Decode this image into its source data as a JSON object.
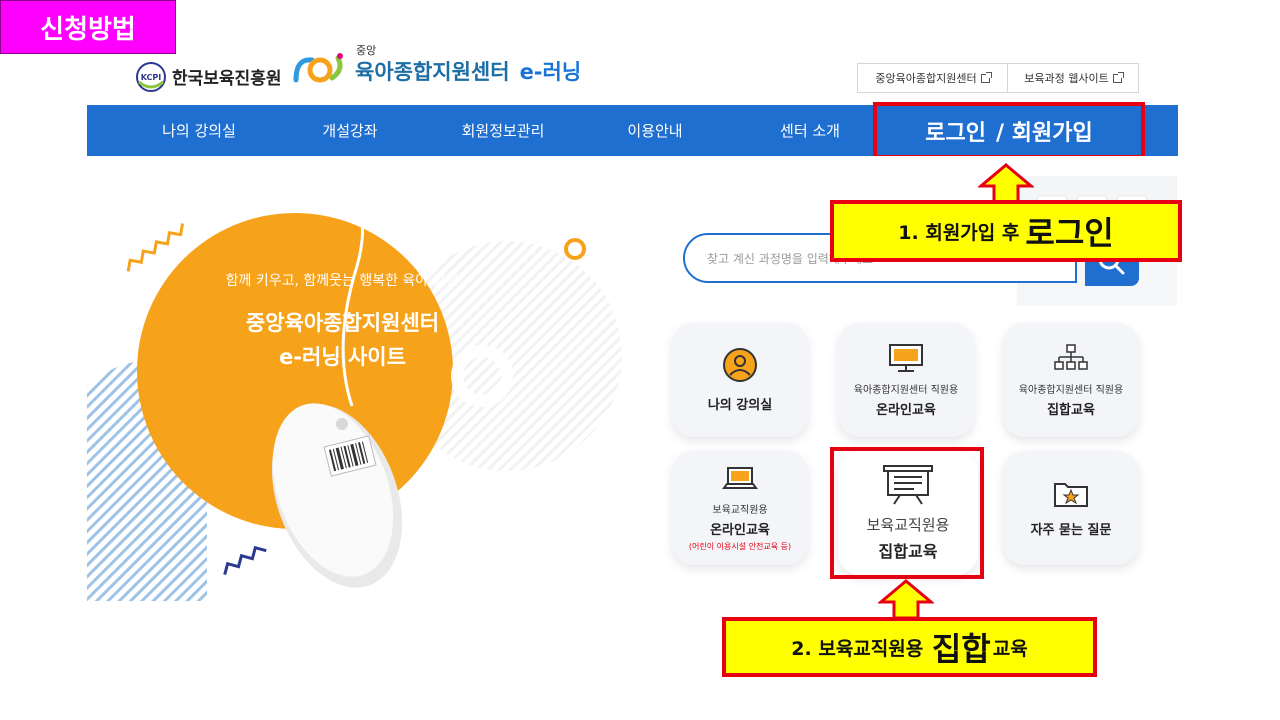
{
  "slide": {
    "title": "신청방법"
  },
  "header": {
    "org_name": "한국보육진흥원",
    "kcpi_badge": "KCPI",
    "center_small": "중앙",
    "center_name": "육아종합지원센터",
    "elearning": "e-러닝",
    "external_links": [
      "중앙육아종합지원센터",
      "보육과정 웹사이트"
    ]
  },
  "nav": {
    "items": [
      "나의 강의실",
      "개설강좌",
      "회원정보관리",
      "이용안내",
      "센터 소개"
    ],
    "login": "로그인",
    "join": "/ 회원가입"
  },
  "hero": {
    "subtitle": "함께 키우고, 함께웃는 행복한 육아 실현",
    "title_line1": "중앙육아종합지원센터",
    "title_line2": "e-러닝 사이트"
  },
  "search": {
    "placeholder": "찾고 계신 과정명을 입력해주세요"
  },
  "tiles": [
    {
      "small": "",
      "bold": "나의 강의실",
      "icon": "user-circle-icon"
    },
    {
      "small": "육아종합지원센터 직원용",
      "bold": "온라인교육",
      "icon": "monitor-icon"
    },
    {
      "small": "육아종합지원센터 직원용",
      "bold": "집합교육",
      "icon": "org-chart-icon"
    },
    {
      "small": "보육교직원용",
      "bold": "온라인교육",
      "note": "(어린이 이용시설 안전교육 등)",
      "icon": "laptop-icon"
    },
    {
      "small": "보육교직원용",
      "bold": "집합교육",
      "icon": "presentation-board-icon"
    },
    {
      "small": "",
      "bold": "자주 묻는 질문",
      "icon": "star-folder-icon"
    }
  ],
  "callouts": {
    "step1_prefix": "1. 회원가입 후",
    "step1_big": "로그인",
    "step2_prefix": "2. 보육교직원용",
    "step2_big": "집합",
    "step2_suffix": "교육"
  },
  "colors": {
    "nav_blue": "#1f6fd1",
    "accent_orange": "#f7a21b",
    "callout_yellow": "#ffff00",
    "callout_red": "#e60012",
    "badge_magenta": "#ff00ff"
  }
}
